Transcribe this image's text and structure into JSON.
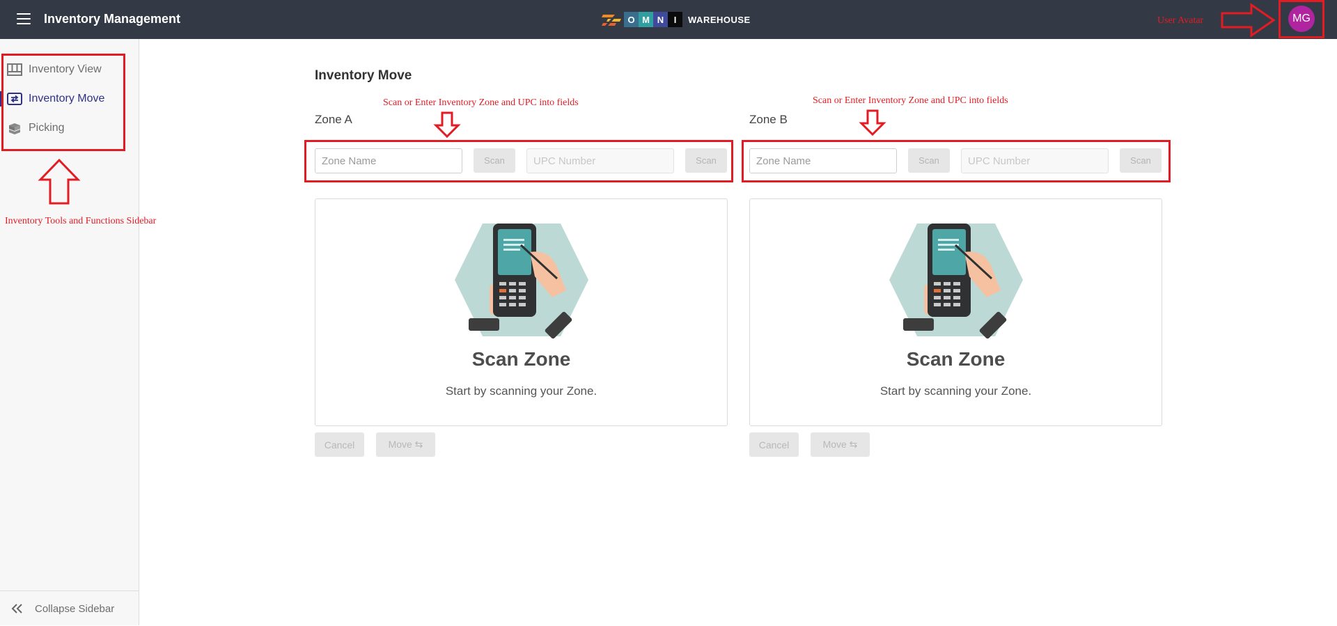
{
  "header": {
    "title": "Inventory Management",
    "logo_letters": [
      "O",
      "M",
      "N",
      "I"
    ],
    "logo_word": "WAREHOUSE",
    "avatar_initials": "MG",
    "colors": {
      "bar": "#343a45",
      "avatar": "#b0259f"
    }
  },
  "sidebar": {
    "items": [
      {
        "label": "Inventory View",
        "icon": "grid-view-icon",
        "active": false
      },
      {
        "label": "Inventory Move",
        "icon": "transfer-icon",
        "active": true
      },
      {
        "label": "Picking",
        "icon": "boxes-icon",
        "active": false
      }
    ],
    "collapse_label": "Collapse Sidebar"
  },
  "main": {
    "title": "Inventory Move",
    "zones": [
      {
        "title": "Zone A",
        "zone_placeholder": "Zone Name",
        "upc_placeholder": "UPC Number",
        "scan_label": "Scan",
        "card_title": "Scan Zone",
        "card_subtitle": "Start by scanning your Zone.",
        "cancel_label": "Cancel",
        "move_label": "Move ⇆"
      },
      {
        "title": "Zone B",
        "zone_placeholder": "Zone Name",
        "upc_placeholder": "UPC Number",
        "scan_label": "Scan",
        "card_title": "Scan Zone",
        "card_subtitle": "Start by scanning your Zone.",
        "cancel_label": "Cancel",
        "move_label": "Move ⇆"
      }
    ]
  },
  "annotations": {
    "sidebar_note": "Inventory Tools and Functions Sidebar",
    "zone_a_note": "Scan or Enter Inventory Zone and UPC into fields",
    "zone_b_note": "Scan or Enter Inventory Zone and UPC into fields",
    "avatar_note": "User Avatar",
    "color": "#e31b23"
  }
}
